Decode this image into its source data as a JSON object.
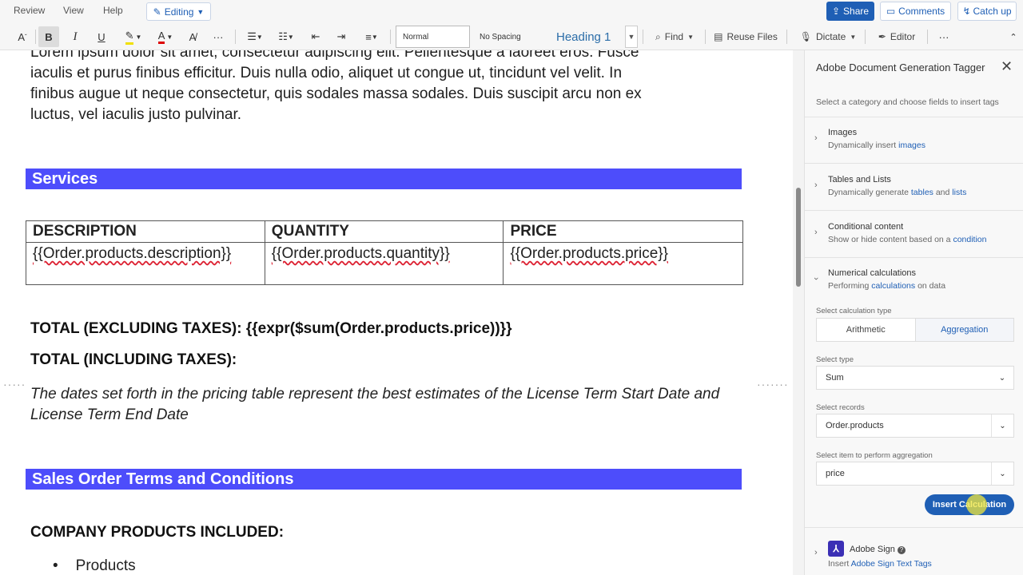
{
  "menu": {
    "items": [
      "Review",
      "View",
      "Help"
    ],
    "editing_label": "Editing",
    "share_label": "Share",
    "comments_label": "Comments",
    "catchup_label": "Catch up"
  },
  "ribbon": {
    "bold": "B",
    "italic": "I",
    "underline": "U",
    "styles": [
      "Normal",
      "No Spacing",
      "Heading 1"
    ],
    "find_label": "Find",
    "reuse_label": "Reuse Files",
    "dictate_label": "Dictate",
    "editor_label": "Editor",
    "more": "···"
  },
  "document": {
    "intro_lines": [
      "Lorem ipsum dolor sit amet, consectetur adipiscing elit. Pellentesque a laoreet eros. Fusce",
      "iaculis et purus finibus efficitur. Duis nulla odio, aliquet ut congue ut, tincidunt vel velit. In",
      "finibus augue ut neque consectetur, quis sodales massa sodales. Duis suscipit arcu non ex",
      "luctus, vel iaculis justo pulvinar."
    ],
    "services_heading": "Services",
    "table": {
      "headers": [
        "DESCRIPTION",
        "QUANTITY",
        "PRICE"
      ],
      "row": [
        "{{Order.products.description}}",
        "{{Order.products.quantity}}",
        "{{Order.products.price}}"
      ]
    },
    "total_excl": "TOTAL (EXCLUDING TAXES): {{expr($sum(Order.products.price))}}",
    "total_incl": "TOTAL (INCLUDING TAXES):",
    "dates_note": "The dates set forth in the pricing table represent the best estimates of the License Term Start Date and License Term End Date",
    "terms_heading": "Sales Order Terms and Conditions",
    "company_products": "COMPANY PRODUCTS INCLUDED:",
    "bullet_item": "Products"
  },
  "panel": {
    "title": "Adobe Document Generation Tagger",
    "subtitle": "Select a category and choose fields to insert tags",
    "categories": [
      {
        "title": "Images",
        "desc_pre": "Dynamically insert ",
        "link1": "images",
        "mid": "",
        "link2": ""
      },
      {
        "title": "Tables and Lists",
        "desc_pre": "Dynamically generate ",
        "link1": "tables",
        "mid": " and ",
        "link2": "lists"
      },
      {
        "title": "Conditional content",
        "desc_pre": "Show or hide content based on a ",
        "link1": "condition",
        "mid": "",
        "link2": ""
      },
      {
        "title": "Numerical calculations",
        "desc_pre": "Performing ",
        "link1": "calculations",
        "mid": " on data",
        "link2": ""
      }
    ],
    "calc_type_label": "Select calculation type",
    "calc_types": [
      "Arithmetic",
      "Aggregation"
    ],
    "type_label": "Select type",
    "type_value": "Sum",
    "records_label": "Select records",
    "records_value": "Order.products",
    "agg_item_label": "Select item to perform aggregation",
    "agg_item_value": "price",
    "insert_label": "Insert Calculation",
    "sign_title": "Adobe Sign",
    "sign_desc_pre": "Insert ",
    "sign_link": "Adobe Sign Text Tags"
  },
  "colors": {
    "section_bar": "#4d4dfb",
    "accent": "#1f5fb5"
  }
}
